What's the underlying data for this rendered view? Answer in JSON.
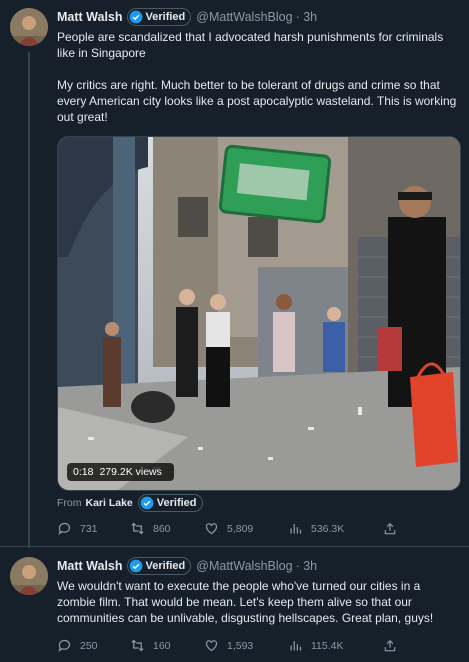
{
  "tweets": [
    {
      "author_name": "Matt Walsh",
      "verified_label": "Verified",
      "handle": "@MattWalshBlog",
      "time": "· 3h",
      "text_p1": "People are scandalized that I advocated harsh punishments for criminals like in Singapore",
      "text_p2": "My critics are right. Much better to be tolerant of drugs and crime so that every American city looks like a post apocalyptic wasteland. This is working out great!",
      "video": {
        "duration": "0:18",
        "views": "279.2K views"
      },
      "from_label": "From",
      "from_source": "Kari Lake",
      "from_verified": "Verified",
      "actions": {
        "replies": "731",
        "retweets": "860",
        "likes": "5,809",
        "views": "536.3K"
      }
    },
    {
      "author_name": "Matt Walsh",
      "verified_label": "Verified",
      "handle": "@MattWalshBlog",
      "time": "· 3h",
      "text": "We wouldn't want to execute the people who've turned our cities in a zombie film. That would be mean. Let's keep them alive so that our communities can be unlivable, disgusting hellscapes. Great plan, guys!",
      "actions": {
        "replies": "250",
        "retweets": "160",
        "likes": "1,593",
        "views": "115.4K"
      }
    }
  ],
  "colors": {
    "background": "#15202b",
    "verified_blue": "#1d9bf0",
    "muted": "#8b98a5",
    "text": "#e7e9ea"
  },
  "icons": [
    "reply-icon",
    "retweet-icon",
    "like-icon",
    "views-icon",
    "share-icon",
    "verified-check-icon"
  ]
}
